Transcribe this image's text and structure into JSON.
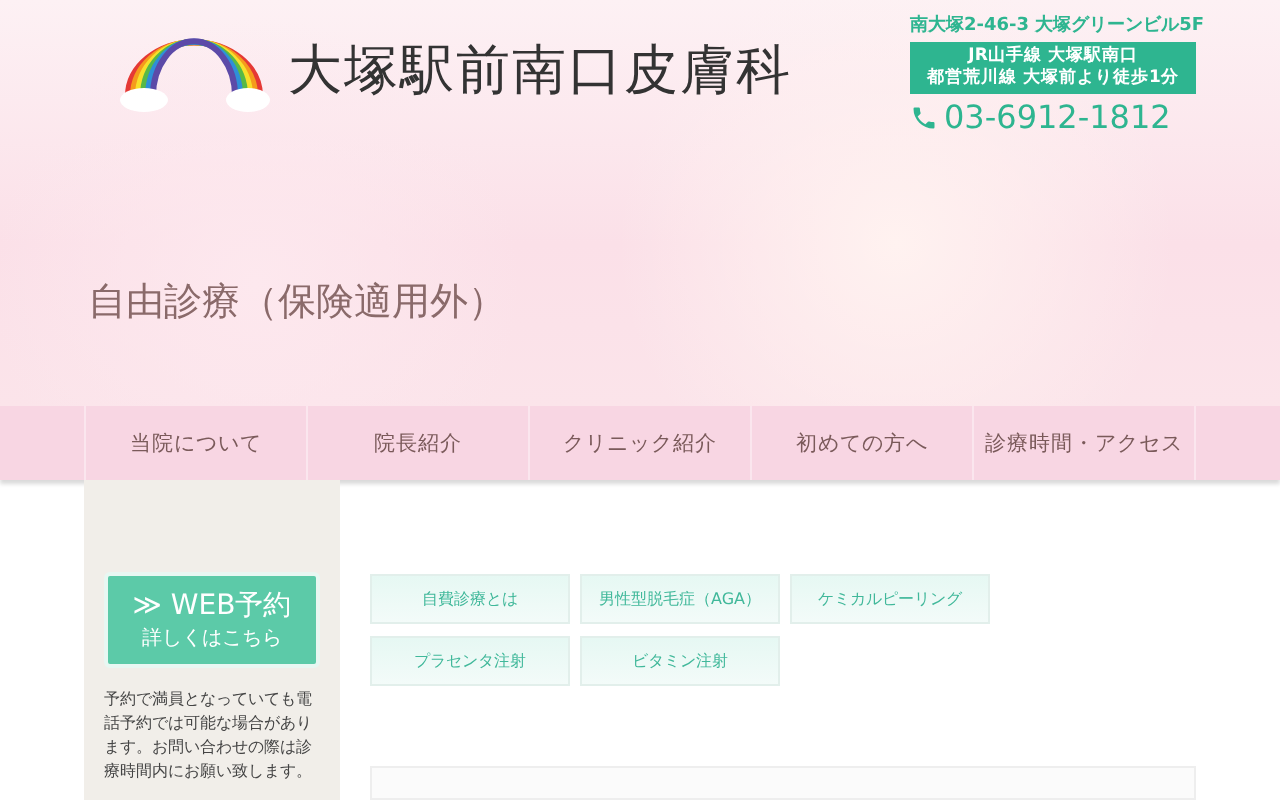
{
  "header": {
    "clinic_name": "大塚駅前南口皮膚科",
    "address": "南大塚2-46-3 大塚グリーンビル5F",
    "access": [
      "JR山手線 大塚駅南口",
      "都営荒川線 大塚前より徒歩1分"
    ],
    "phone": "03-6912-1812"
  },
  "page_title": "自由診療（保険適用外）",
  "nav": [
    {
      "label": "当院について"
    },
    {
      "label": "院長紹介"
    },
    {
      "label": "クリニック紹介"
    },
    {
      "label": "初めての方へ"
    },
    {
      "label": "診療時間・アクセス"
    }
  ],
  "sidebar": {
    "reserve_button": {
      "arrow": "≫",
      "title": "WEB予約",
      "subtitle": "詳しくはこちら"
    },
    "note": "予約で満員となっていても電話予約では可能な場合があります。お問い合わせの際は診療時間内にお願い致します。"
  },
  "menu_buttons": [
    {
      "label": "自費診療とは"
    },
    {
      "label": "男性型脱毛症（AGA）"
    },
    {
      "label": "ケミカルピーリング"
    },
    {
      "label": "プラセンタ注射"
    },
    {
      "label": "ビタミン注射"
    }
  ]
}
